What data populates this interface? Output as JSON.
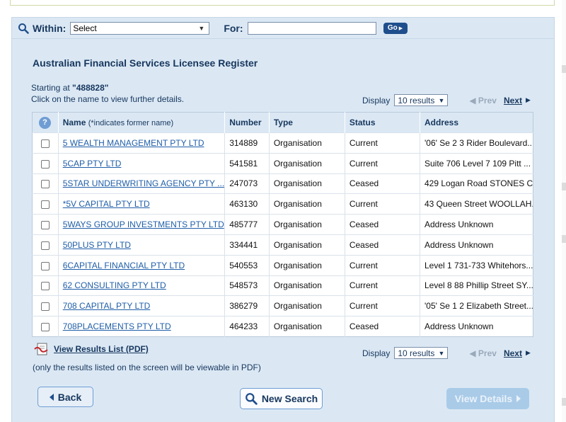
{
  "search": {
    "within_label": "Within:",
    "within_value": "Select",
    "for_label": "For:",
    "for_value": "",
    "go_label": "Go"
  },
  "page": {
    "title": "Australian Financial Services Licensee Register",
    "starting_prefix": "Starting at ",
    "starting_value": "\"488828\"",
    "click_note": "Click on the name to view further details."
  },
  "pager": {
    "display_label": "Display",
    "results_value": "10 results",
    "prev_label": "Prev",
    "next_label": "Next"
  },
  "table": {
    "headers": {
      "help": "?",
      "name": "Name",
      "name_note": "(*indicates former name)",
      "number": "Number",
      "type": "Type",
      "status": "Status",
      "address": "Address"
    },
    "rows": [
      {
        "name": "5 WEALTH MANAGEMENT PTY LTD",
        "number": "314889",
        "type": "Organisation",
        "status": "Current",
        "address": "'06' Se 2 3 Rider Boulevard..."
      },
      {
        "name": "5CAP PTY LTD",
        "number": "541581",
        "type": "Organisation",
        "status": "Current",
        "address": "Suite 706 Level 7 109 Pitt ..."
      },
      {
        "name": "5STAR UNDERWRITING AGENCY PTY ...",
        "number": "247073",
        "type": "Organisation",
        "status": "Ceased",
        "address": "429 Logan Road STONES C..."
      },
      {
        "name": "*5V CAPITAL PTY LTD",
        "number": "463130",
        "type": "Organisation",
        "status": "Current",
        "address": "43 Queen Street WOOLLAH..."
      },
      {
        "name": "5WAYS GROUP INVESTMENTS PTY LTD",
        "number": "485777",
        "type": "Organisation",
        "status": "Ceased",
        "address": "Address Unknown"
      },
      {
        "name": "50PLUS PTY LTD",
        "number": "334441",
        "type": "Organisation",
        "status": "Ceased",
        "address": "Address Unknown"
      },
      {
        "name": "6CAPITAL FINANCIAL PTY LTD",
        "number": "540553",
        "type": "Organisation",
        "status": "Current",
        "address": "Level 1 731-733 Whitehors..."
      },
      {
        "name": "62 CONSULTING PTY LTD",
        "number": "548573",
        "type": "Organisation",
        "status": "Current",
        "address": "Level 8 88 Phillip Street SY..."
      },
      {
        "name": "708 CAPITAL PTY LTD",
        "number": "386279",
        "type": "Organisation",
        "status": "Current",
        "address": "'05' Se 1 2 Elizabeth Street..."
      },
      {
        "name": "708PLACEMENTS PTY LTD",
        "number": "464233",
        "type": "Organisation",
        "status": "Ceased",
        "address": "Address Unknown"
      }
    ]
  },
  "pdf": {
    "link_label": "View Results List (PDF)",
    "note": "(only the results listed on the screen will be viewable in PDF)"
  },
  "buttons": {
    "back": "Back",
    "new_search": "New Search",
    "view_details": "View Details"
  },
  "colors": {
    "panel_bg": "#dbe8f4",
    "title_text": "#17375e",
    "link": "#1f5ea8",
    "go_button": "#1f4e8c",
    "disabled_button": "#a9cbe8"
  }
}
